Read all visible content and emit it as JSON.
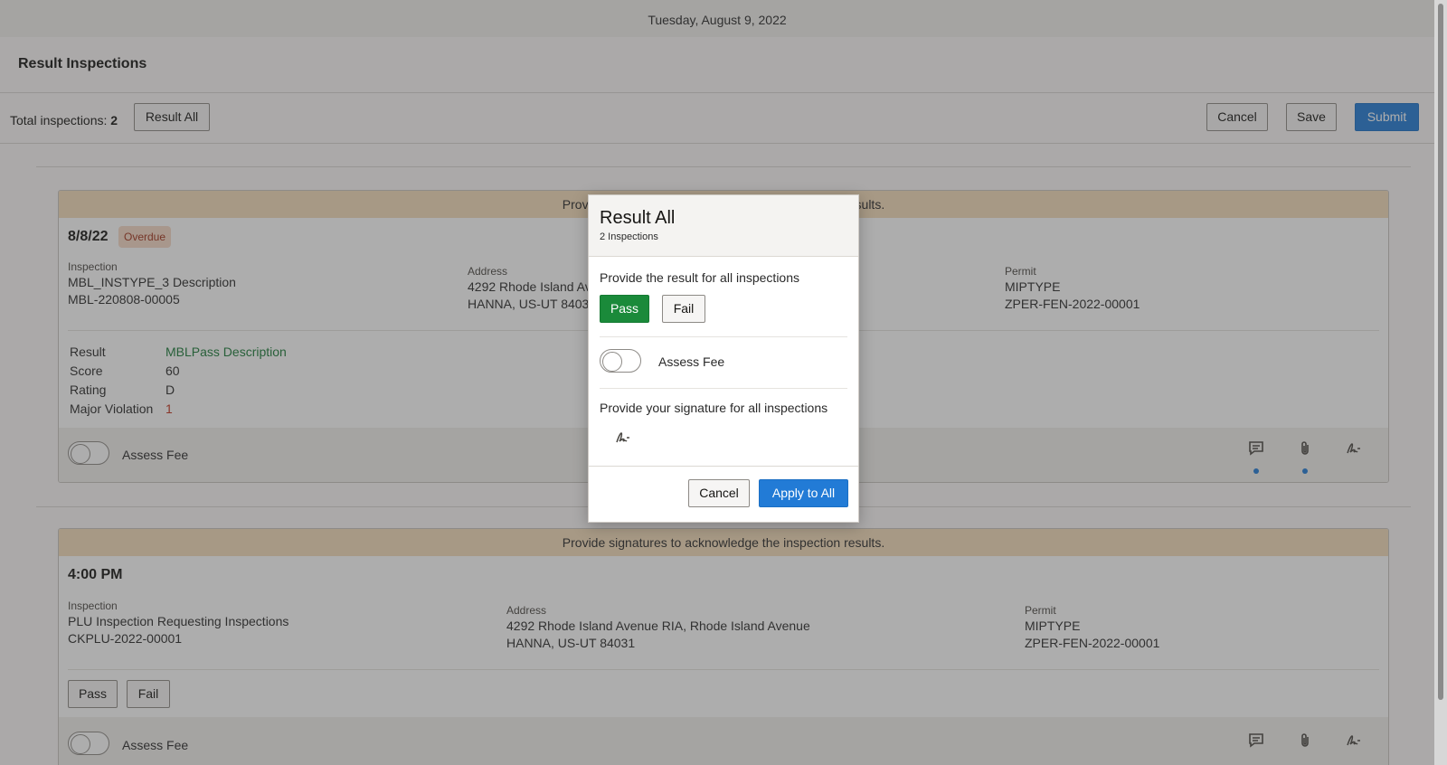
{
  "header": {
    "date": "Tuesday, August 9, 2022",
    "title": "Result Inspections"
  },
  "toolbar": {
    "total_label": "Total inspections:",
    "total_count": "2",
    "result_all": "Result All",
    "cancel": "Cancel",
    "save": "Save",
    "submit": "Submit"
  },
  "cards": [
    {
      "banner": "Provide signatures to acknowledge the inspection results.",
      "date": "8/8/22",
      "badge": "Overdue",
      "inspection_label": "Inspection",
      "inspection_line1": "MBL_INSTYPE_3 Description",
      "inspection_line2": "MBL-220808-00005",
      "address_label": "Address",
      "address_line1": "4292 Rhode Island Avenue RIA, Rhode Island Avenue",
      "address_line2": "HANNA, US-UT 84031",
      "permit_label": "Permit",
      "permit_line1": "MIPTYPE",
      "permit_line2": "ZPER-FEN-2022-00001",
      "result_key": "Result",
      "result_val": "MBLPass Description",
      "score_key": "Score",
      "score_val": "60",
      "rating_key": "Rating",
      "rating_val": "D",
      "violation_key": "Major Violation",
      "violation_val": "1",
      "assess_fee": "Assess Fee"
    },
    {
      "banner": "Provide signatures to acknowledge the inspection results.",
      "date": "4:00 PM",
      "inspection_label": "Inspection",
      "inspection_line1": "PLU Inspection Requesting Inspections",
      "inspection_line2": "CKPLU-2022-00001",
      "address_label": "Address",
      "address_line1": "4292 Rhode Island Avenue RIA, Rhode Island Avenue",
      "address_line2": "HANNA, US-UT 84031",
      "permit_label": "Permit",
      "permit_line1": "MIPTYPE",
      "permit_line2": "ZPER-FEN-2022-00001",
      "pass": "Pass",
      "fail": "Fail",
      "assess_fee": "Assess Fee"
    }
  ],
  "dialog": {
    "title": "Result All",
    "subtitle": "2 Inspections",
    "prompt_result": "Provide the result for all inspections",
    "pass": "Pass",
    "fail": "Fail",
    "assess_fee": "Assess Fee",
    "prompt_signature": "Provide your signature for all inspections",
    "cancel": "Cancel",
    "apply": "Apply to All"
  },
  "colors": {
    "primary": "#227bd6",
    "pass_green": "#1a8a3a",
    "banner": "#f4dcbb",
    "overdue_text": "#a1331b"
  },
  "icons": [
    "comment-icon",
    "attachment-icon",
    "signature-icon"
  ]
}
